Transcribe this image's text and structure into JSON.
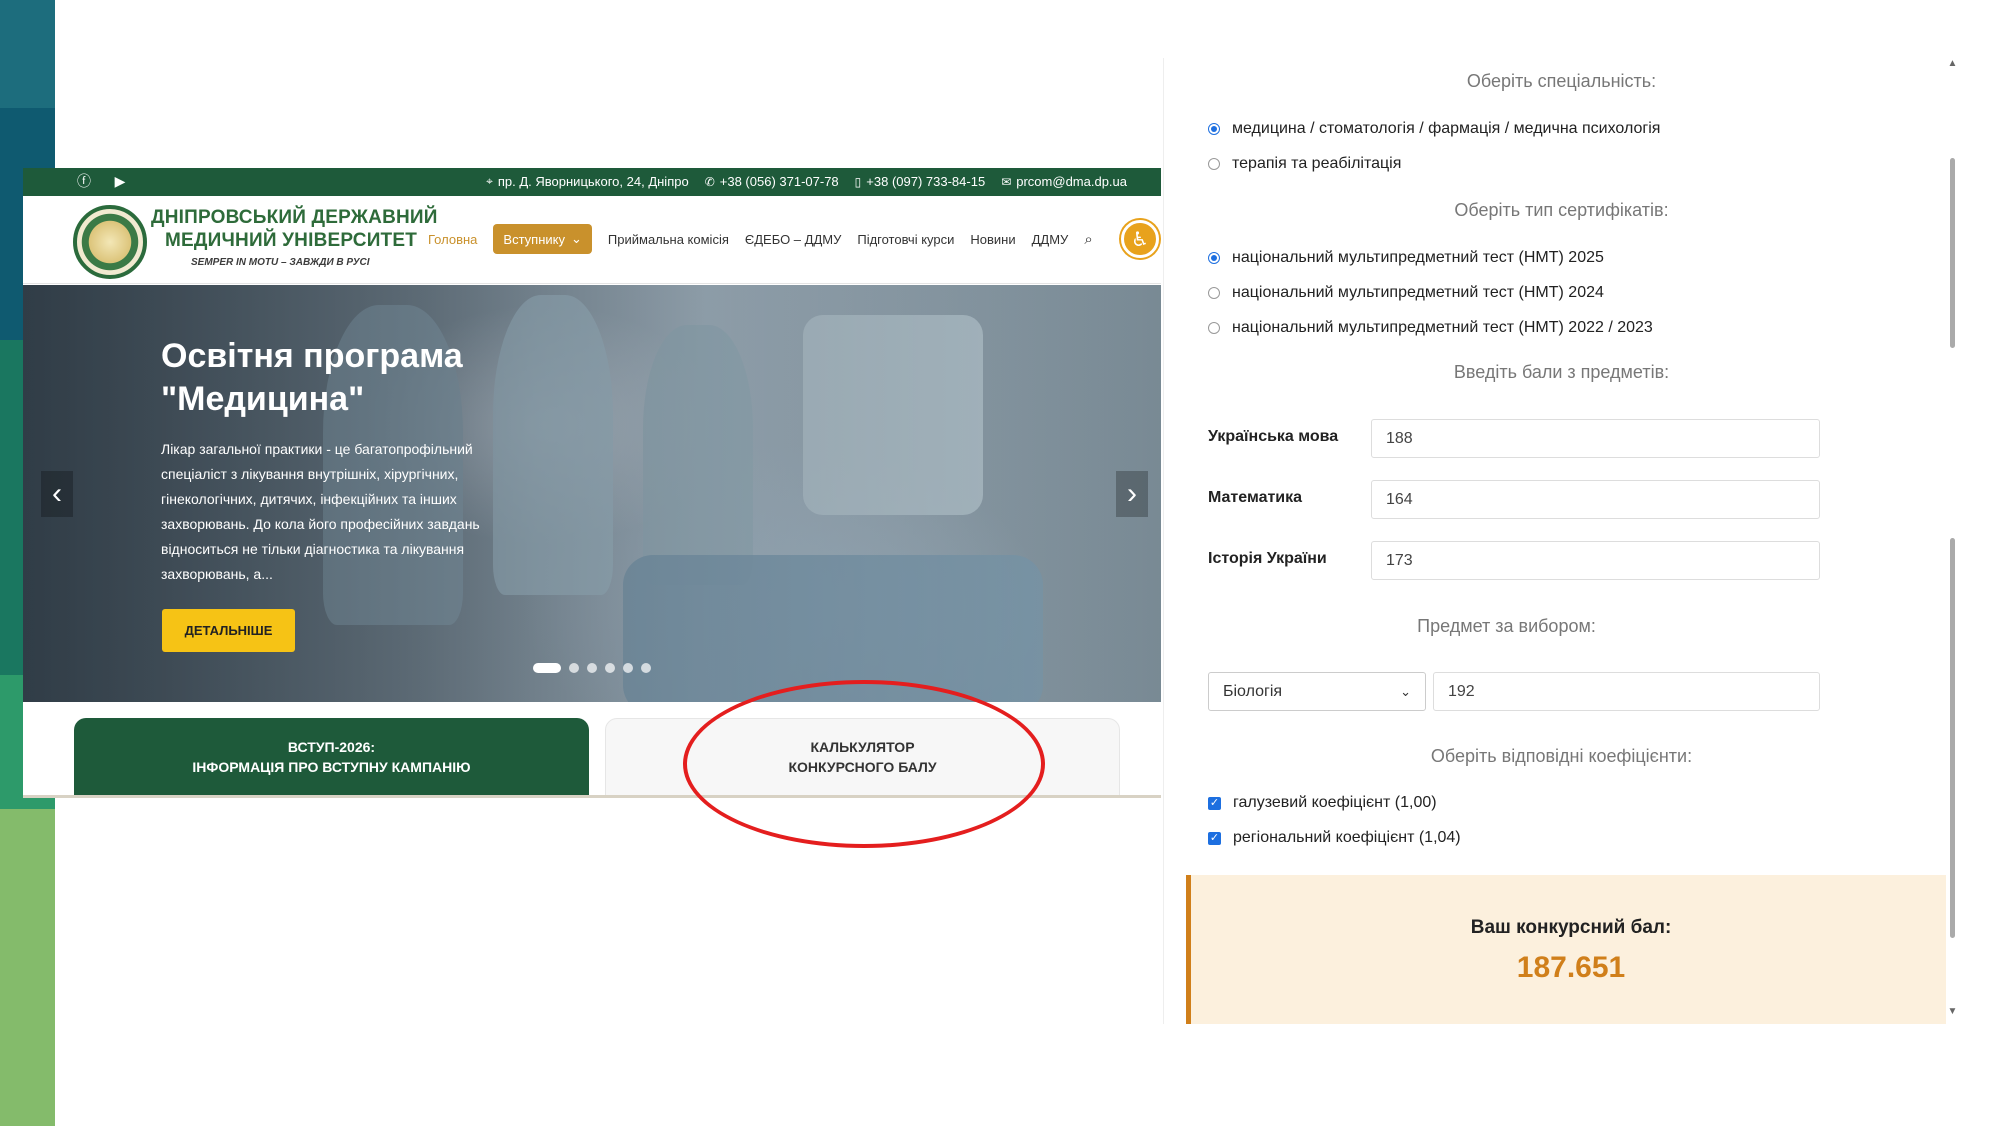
{
  "site": {
    "topbar": {
      "social": [
        "facebook-icon",
        "youtube-icon"
      ],
      "address": "пр. Д. Яворницького, 24, Дніпро",
      "phone1": "+38 (056) 371-07-78",
      "phone2": "+38 (097) 733-84-15",
      "email": "prcom@dma.dp.ua"
    },
    "logo": {
      "line1": "ДНІПРОВСЬКИЙ ДЕРЖАВНИЙ",
      "line2": "МЕДИЧНИЙ УНІВЕРСИТЕТ",
      "motto": "SEMPER IN MOTU – ЗАВЖДИ В РУСІ"
    },
    "menu": {
      "home": "Головна",
      "applicant": "Вступнику",
      "admissions": "Приймальна комісія",
      "edebo": "ЄДЕБО – ДДМУ",
      "courses": "Підготовчі курси",
      "news": "Новини",
      "ddmu": "ДДМУ"
    },
    "hero": {
      "title": "Освітня програма \"Медицина\"",
      "description": "Лікар загальної практики - це багатопрофільний спеціаліст з лікування внутрішніх, хірургічних, гінекологічних, дитячих, інфекційних та інших захворювань. До кола його професійних завдань відноситься не тільки діагностика та лікування захворювань, а...",
      "button": "ДЕТАЛЬНІШЕ",
      "slides": 6,
      "active_slide": 1
    },
    "cards": {
      "card1_line1": "ВСТУП-2026:",
      "card1_line2": "ІНФОРМАЦІЯ ПРО ВСТУПНУ КАМПАНІЮ",
      "card2_line1": "КАЛЬКУЛЯТОР",
      "card2_line2": "КОНКУРСНОГО БАЛУ"
    }
  },
  "calculator": {
    "specialty_heading": "Оберіть спеціальність:",
    "specialties": [
      {
        "label": "медицина / стоматологія / фармація / медична психологія",
        "selected": true
      },
      {
        "label": "терапія та реабілітація",
        "selected": false
      }
    ],
    "cert_heading": "Оберіть тип сертифікатів:",
    "certs": [
      {
        "label": "національний мультипредметний тест (НМТ) 2025",
        "selected": true
      },
      {
        "label": "національний мультипредметний тест (НМТ) 2024",
        "selected": false
      },
      {
        "label": "національний мультипредметний тест (НМТ) 2022 / 2023",
        "selected": false
      }
    ],
    "scores_heading": "Введіть бали з предметів:",
    "subjects": [
      {
        "label": "Українська мова",
        "value": "188"
      },
      {
        "label": "Математика",
        "value": "164"
      },
      {
        "label": "Історія України",
        "value": "173"
      }
    ],
    "elective_heading": "Предмет за вибором:",
    "elective_subject": "Біологія",
    "elective_value": "192",
    "coef_heading": "Оберіть відповідні коефіцієнти:",
    "coefficients": [
      {
        "label": "галузевий коефіцієнт (1,00)",
        "checked": true
      },
      {
        "label": "регіональний коефіцієнт (1,04)",
        "checked": true
      }
    ],
    "result_label": "Ваш конкурсний бал:",
    "result_value": "187.651"
  },
  "colors": {
    "brand_green": "#1e5a3a",
    "accent_gold": "#c9912c",
    "cta_yellow": "#f6c315",
    "highlight_red": "#e41e1e",
    "result_orange": "#d07f1a",
    "radio_blue": "#1d6fe0"
  }
}
